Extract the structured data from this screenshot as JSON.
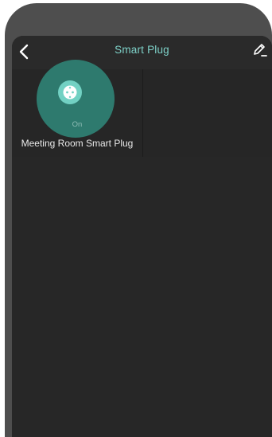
{
  "header": {
    "title": "Smart Plug",
    "back_icon": "chevron-left-icon",
    "edit_icon": "pencil-icon"
  },
  "devices": [
    {
      "name": "Meeting Room Smart Plug",
      "status": "On",
      "icon": "outlet-icon"
    }
  ],
  "colors": {
    "accent": "#7ed1c8",
    "device_ripple": "#2e7e72",
    "device_icon_bg": "#72d1c3",
    "screen_bg": "#272727",
    "shell_bg": "#4e4e4e"
  }
}
